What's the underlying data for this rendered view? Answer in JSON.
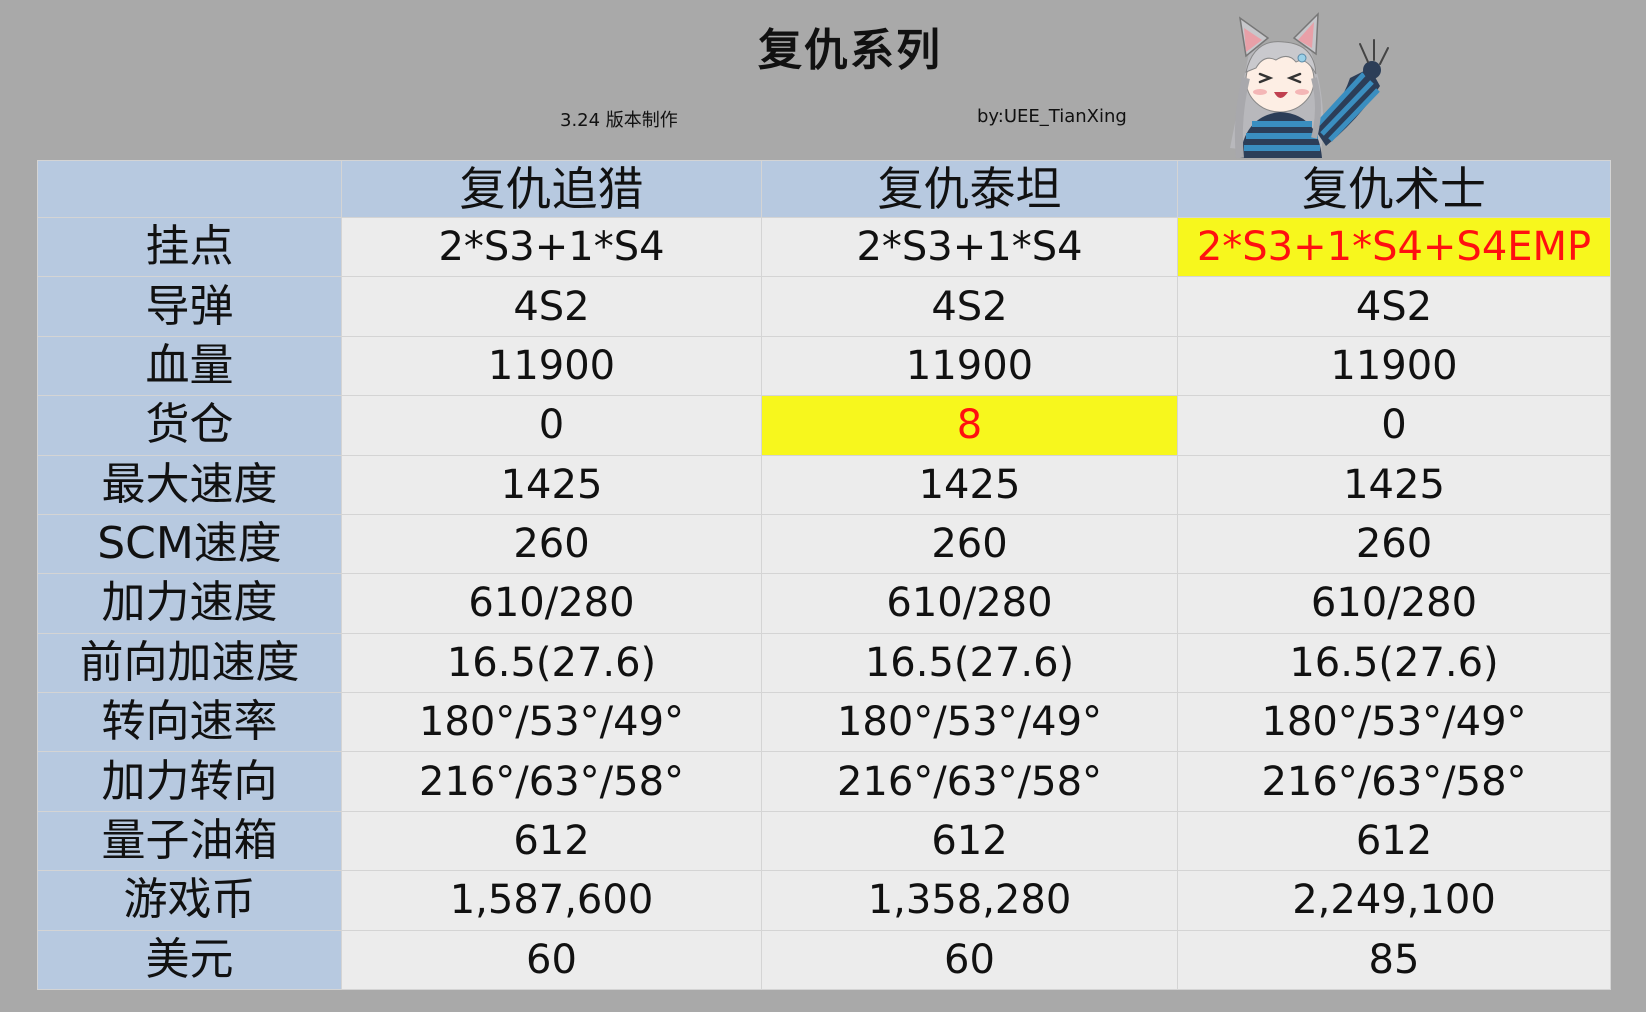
{
  "header": {
    "title": "复仇系列",
    "version": "3.24 版本制作",
    "author": "by:UEE_TianXing"
  },
  "colors": {
    "background": "#a9a9a9",
    "header_fill": "#b7c9e0",
    "cell_fill": "#ececec",
    "highlight_fill": "#f7f71d",
    "highlight_text": "#ff1010"
  },
  "table": {
    "columns": [
      "",
      "复仇追猎",
      "复仇泰坦",
      "复仇术士"
    ],
    "rows": [
      {
        "label": "挂点",
        "values": [
          "2*S3+1*S4",
          "2*S3+1*S4",
          "2*S3+1*S4+S4EMP"
        ],
        "highlight": [
          false,
          false,
          true
        ]
      },
      {
        "label": "导弹",
        "values": [
          "4S2",
          "4S2",
          "4S2"
        ],
        "highlight": [
          false,
          false,
          false
        ]
      },
      {
        "label": "血量",
        "values": [
          "11900",
          "11900",
          "11900"
        ],
        "highlight": [
          false,
          false,
          false
        ]
      },
      {
        "label": "货仓",
        "values": [
          "0",
          "8",
          "0"
        ],
        "highlight": [
          false,
          true,
          false
        ]
      },
      {
        "label": "最大速度",
        "values": [
          "1425",
          "1425",
          "1425"
        ],
        "highlight": [
          false,
          false,
          false
        ]
      },
      {
        "label": "SCM速度",
        "values": [
          "260",
          "260",
          "260"
        ],
        "highlight": [
          false,
          false,
          false
        ]
      },
      {
        "label": "加力速度",
        "values": [
          "610/280",
          "610/280",
          "610/280"
        ],
        "highlight": [
          false,
          false,
          false
        ]
      },
      {
        "label": "前向加速度",
        "values": [
          "16.5(27.6)",
          "16.5(27.6)",
          "16.5(27.6)"
        ],
        "highlight": [
          false,
          false,
          false
        ]
      },
      {
        "label": "转向速率",
        "values": [
          "180°/53°/49°",
          "180°/53°/49°",
          "180°/53°/49°"
        ],
        "highlight": [
          false,
          false,
          false
        ]
      },
      {
        "label": "加力转向",
        "values": [
          "216°/63°/58°",
          "216°/63°/58°",
          "216°/63°/58°"
        ],
        "highlight": [
          false,
          false,
          false
        ]
      },
      {
        "label": "量子油箱",
        "values": [
          "612",
          "612",
          "612"
        ],
        "highlight": [
          false,
          false,
          false
        ]
      },
      {
        "label": "游戏币",
        "values": [
          "1,587,600",
          "1,358,280",
          "2,249,100"
        ],
        "highlight": [
          false,
          false,
          false
        ]
      },
      {
        "label": "美元",
        "values": [
          "60",
          "60",
          "85"
        ],
        "highlight": [
          false,
          false,
          false
        ]
      }
    ]
  },
  "mascot": {
    "icon": "cat-girl-mascot-icon"
  }
}
